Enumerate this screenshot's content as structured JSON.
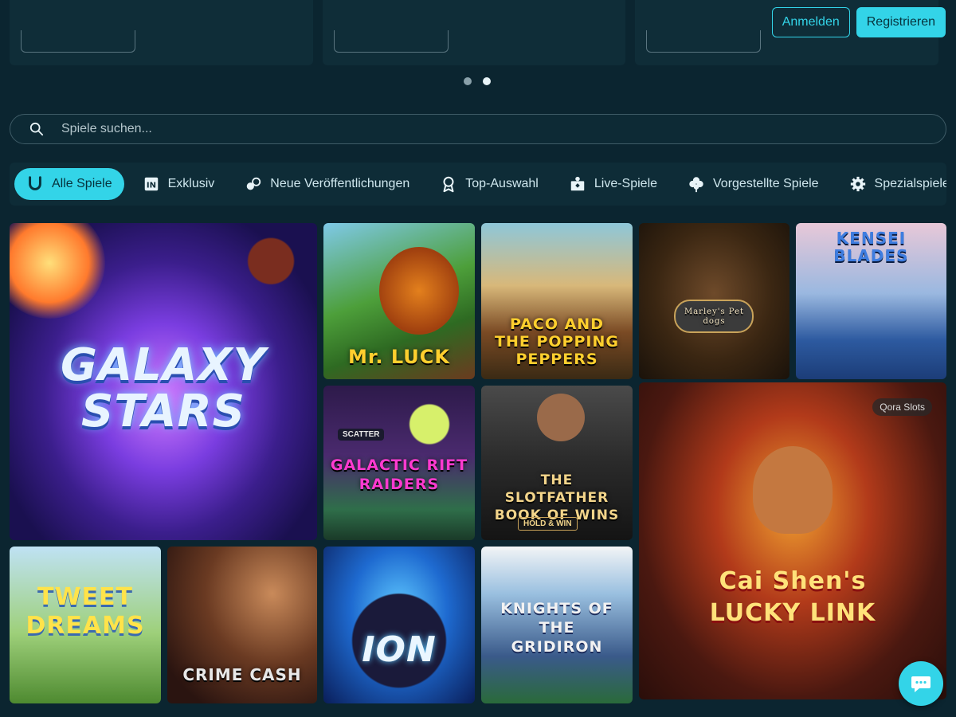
{
  "header": {
    "login_label": "Anmelden",
    "register_label": "Registrieren"
  },
  "carousel": {
    "dot_count": 2,
    "active_dot": 2
  },
  "search": {
    "placeholder": "Spiele suchen..."
  },
  "tabs": [
    {
      "label": "Alle Spiele",
      "icon": "horseshoe-icon",
      "active": true
    },
    {
      "label": "Exklusiv",
      "icon": "exclusive-icon",
      "active": false
    },
    {
      "label": "Neue Veröffentlichungen",
      "icon": "new-releases-icon",
      "active": false
    },
    {
      "label": "Top-Auswahl",
      "icon": "award-icon",
      "active": false
    },
    {
      "label": "Live-Spiele",
      "icon": "live-dealer-icon",
      "active": false
    },
    {
      "label": "Vorgestellte Spiele",
      "icon": "clover-icon",
      "active": false
    },
    {
      "label": "Spezialspiele",
      "icon": "gear-icon",
      "active": false
    }
  ],
  "games": [
    {
      "title": "GALAXY STARS"
    },
    {
      "title": "Mr. LUCK"
    },
    {
      "title": "PACO AND THE POPPING PEPPERS"
    },
    {
      "title": "Marley's Pet dogs"
    },
    {
      "title": "KENSEI BLADES"
    },
    {
      "title": "GALACTIC RIFT RAIDERS",
      "extra": "SCATTER"
    },
    {
      "title": "THE SLOTFATHER BOOK OF WINS",
      "extra": "HOLD & WIN"
    },
    {
      "title": "Cai Shen's LUCKY LINK",
      "badge": "Qora Slots"
    },
    {
      "title": "TWEET DREAMS"
    },
    {
      "title": "CRIME CASH"
    },
    {
      "title": "ION"
    },
    {
      "title": "KNIGHTS OF THE GRIDIRON"
    }
  ],
  "colors": {
    "background": "#0b2530",
    "accent": "#33d4e8"
  }
}
